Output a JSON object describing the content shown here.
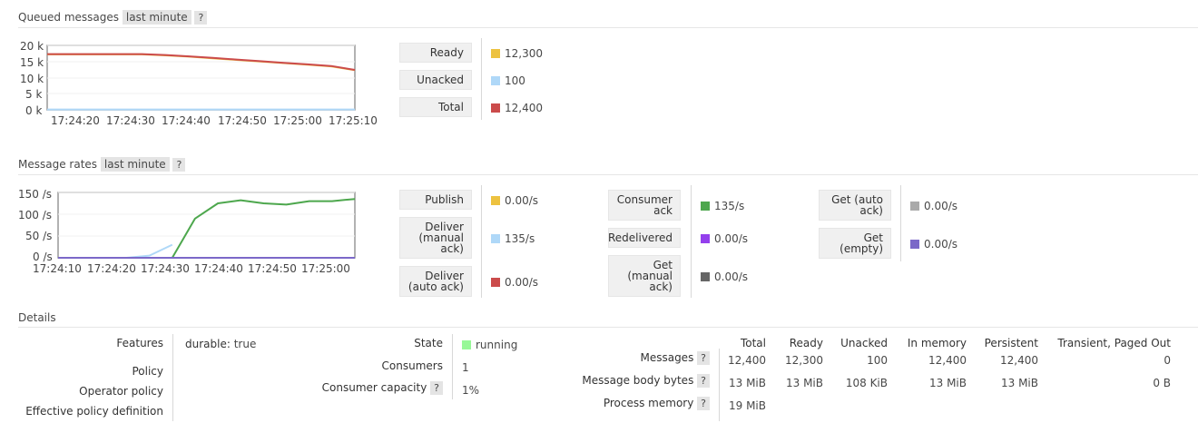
{
  "queued": {
    "title": "Queued messages",
    "range": "last minute",
    "help": "?",
    "legend": [
      {
        "label": "Ready",
        "value": "12,300",
        "color": "#edc240"
      },
      {
        "label": "Unacked",
        "value": "100",
        "color": "#afd8f8"
      },
      {
        "label": "Total",
        "value": "12,400",
        "color": "#cb4b4b"
      }
    ]
  },
  "rates": {
    "title": "Message rates",
    "range": "last minute",
    "help": "?",
    "legend_col1": [
      {
        "label": "Publish",
        "value": "0.00/s",
        "color": "#edc240"
      },
      {
        "label": "Deliver (manual ack)",
        "value": "135/s",
        "color": "#afd8f8"
      },
      {
        "label": "Deliver (auto ack)",
        "value": "0.00/s",
        "color": "#cb4b4b"
      }
    ],
    "legend_col2": [
      {
        "label": "Consumer ack",
        "value": "135/s",
        "color": "#4da74d"
      },
      {
        "label": "Redelivered",
        "value": "0.00/s",
        "color": "#9440ed"
      },
      {
        "label": "Get (manual ack)",
        "value": "0.00/s",
        "color": "#666666"
      }
    ],
    "legend_col3": [
      {
        "label": "Get (auto ack)",
        "value": "0.00/s",
        "color": "#aaaaaa"
      },
      {
        "label": "Get (empty)",
        "value": "0.00/s",
        "color": "#7b68c8"
      }
    ]
  },
  "chart_data": [
    {
      "type": "line",
      "title": "Queued messages",
      "x": [
        "17:24:10",
        "17:24:15",
        "17:24:20",
        "17:24:25",
        "17:24:30",
        "17:24:35",
        "17:24:40",
        "17:24:45",
        "17:24:50",
        "17:24:55",
        "17:25:00",
        "17:25:05",
        "17:25:10",
        "17:25:15"
      ],
      "x_ticks": [
        "17:24:20",
        "17:24:30",
        "17:24:40",
        "17:24:50",
        "17:25:00",
        "17:25:10"
      ],
      "y_ticks": [
        "20 k",
        "15 k",
        "10 k",
        "5 k",
        "0 k"
      ],
      "ylim": [
        0,
        20000
      ],
      "series": [
        {
          "name": "Ready",
          "color": "#edc240",
          "values": [
            17200,
            17200,
            17200,
            17200,
            17200,
            16900,
            16500,
            16000,
            15500,
            15000,
            14500,
            14000,
            13500,
            12300
          ]
        },
        {
          "name": "Unacked",
          "color": "#afd8f8",
          "values": [
            100,
            100,
            100,
            100,
            100,
            100,
            100,
            100,
            100,
            100,
            100,
            100,
            100,
            100
          ]
        },
        {
          "name": "Total",
          "color": "#cb4b4b",
          "values": [
            17300,
            17300,
            17300,
            17300,
            17300,
            17000,
            16600,
            16100,
            15600,
            15100,
            14600,
            14100,
            13600,
            12400
          ]
        }
      ]
    },
    {
      "type": "line",
      "title": "Message rates",
      "x": [
        "17:24:10",
        "17:24:15",
        "17:24:20",
        "17:24:25",
        "17:24:30",
        "17:24:35",
        "17:24:40",
        "17:24:45",
        "17:24:50",
        "17:24:55",
        "17:25:00",
        "17:25:05",
        "17:25:10"
      ],
      "x_ticks": [
        "17:24:10",
        "17:24:20",
        "17:24:30",
        "17:24:40",
        "17:24:50",
        "17:25:00"
      ],
      "y_ticks": [
        "150 /s",
        "100 /s",
        "50 /s",
        "0 /s"
      ],
      "ylim": [
        0,
        150
      ],
      "series": [
        {
          "name": "Deliver (manual ack)",
          "color": "#afd8f8",
          "values": [
            0,
            0,
            0,
            0,
            5,
            30,
            null,
            null,
            null,
            null,
            null,
            null,
            null,
            null
          ]
        },
        {
          "name": "Consumer ack",
          "color": "#4da74d",
          "values": [
            0,
            0,
            0,
            0,
            0,
            0,
            90,
            125,
            132,
            125,
            122,
            130,
            130,
            135
          ]
        },
        {
          "name": "Publish",
          "color": "#7b68c8",
          "values": [
            0,
            0,
            0,
            0,
            0,
            0,
            0,
            0,
            0,
            0,
            0,
            0,
            0,
            0
          ]
        }
      ]
    }
  ],
  "details": {
    "title": "Details",
    "features_label": "Features",
    "features_key": "durable:",
    "features_value": "true",
    "policy_label": "Policy",
    "operator_policy_label": "Operator policy",
    "effective_policy_label": "Effective policy definition",
    "state_label": "State",
    "state_value": "running",
    "consumers_label": "Consumers",
    "consumers_value": "1",
    "capacity_label": "Consumer capacity",
    "capacity_help": "?",
    "capacity_value": "1%",
    "table": {
      "headers": [
        "Total",
        "Ready",
        "Unacked",
        "In memory",
        "Persistent",
        "Transient, Paged Out"
      ],
      "rows": [
        {
          "label": "Messages",
          "help": "?",
          "values": [
            "12,400",
            "12,300",
            "100",
            "12,400",
            "12,400",
            "0"
          ]
        },
        {
          "label": "Message body bytes",
          "help": "?",
          "values": [
            "13 MiB",
            "13 MiB",
            "108 KiB",
            "13 MiB",
            "13 MiB",
            "0 B"
          ]
        },
        {
          "label": "Process memory",
          "help": "?",
          "values": [
            "19 MiB",
            "",
            "",
            "",
            "",
            ""
          ]
        }
      ]
    }
  }
}
